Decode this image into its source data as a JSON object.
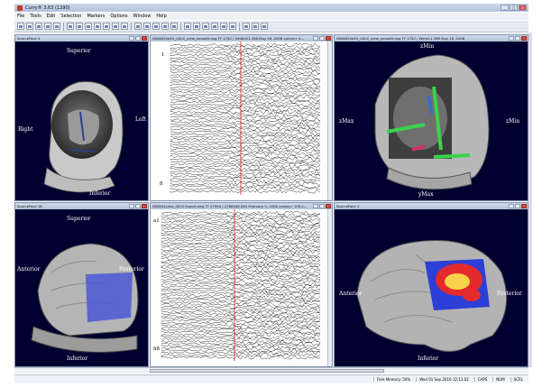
{
  "app": {
    "title": "Curry® 3.63 (1290)"
  },
  "menu": [
    "File",
    "Tools",
    "Edit",
    "Selection",
    "Markers",
    "Options",
    "Window",
    "Help"
  ],
  "windows": {
    "w1": {
      "title": "SourceFace 4",
      "labels": {
        "top": "Superior",
        "left": "Right",
        "right": "Left",
        "bottom": "Inferior"
      }
    },
    "w2": {
      "title": "080805VAEX_0002_cntw_smooth.eeg   TF 2762 / 2648421.388   May 18, 2008   values= 4...",
      "rows": {
        "first": "1",
        "last": "8"
      }
    },
    "w3": {
      "title": "080805VAEX_0002_cntw_smooth.eeg   TF 2762 / Wells11.388   May 18, 2008",
      "labels": {
        "top": "zMin",
        "left": "zMax",
        "right": "zMin",
        "bottom": "yMax"
      }
    },
    "w4": {
      "title": "SourceFace 18",
      "labels": {
        "top": "Superior",
        "left": "Anterior",
        "right": "Posterior",
        "bottom": "Inferior"
      }
    },
    "w5": {
      "title": "080805ynka_0002 Export.eeg   TF 27994 / 2768548.964   February 5, 2008   values= 109.2...",
      "rows": {
        "first": "a1",
        "last": "h8"
      }
    },
    "w6": {
      "title": "SourceFace 4",
      "labels": {
        "top": "",
        "left": "Anterior",
        "right": "Posterior",
        "bottom": "Inferior"
      }
    }
  },
  "status": [
    "Free Memory: 56%",
    "Wed 01 Sep 2010  12:13:02",
    "CAPS",
    "NUM",
    "SCRL"
  ]
}
